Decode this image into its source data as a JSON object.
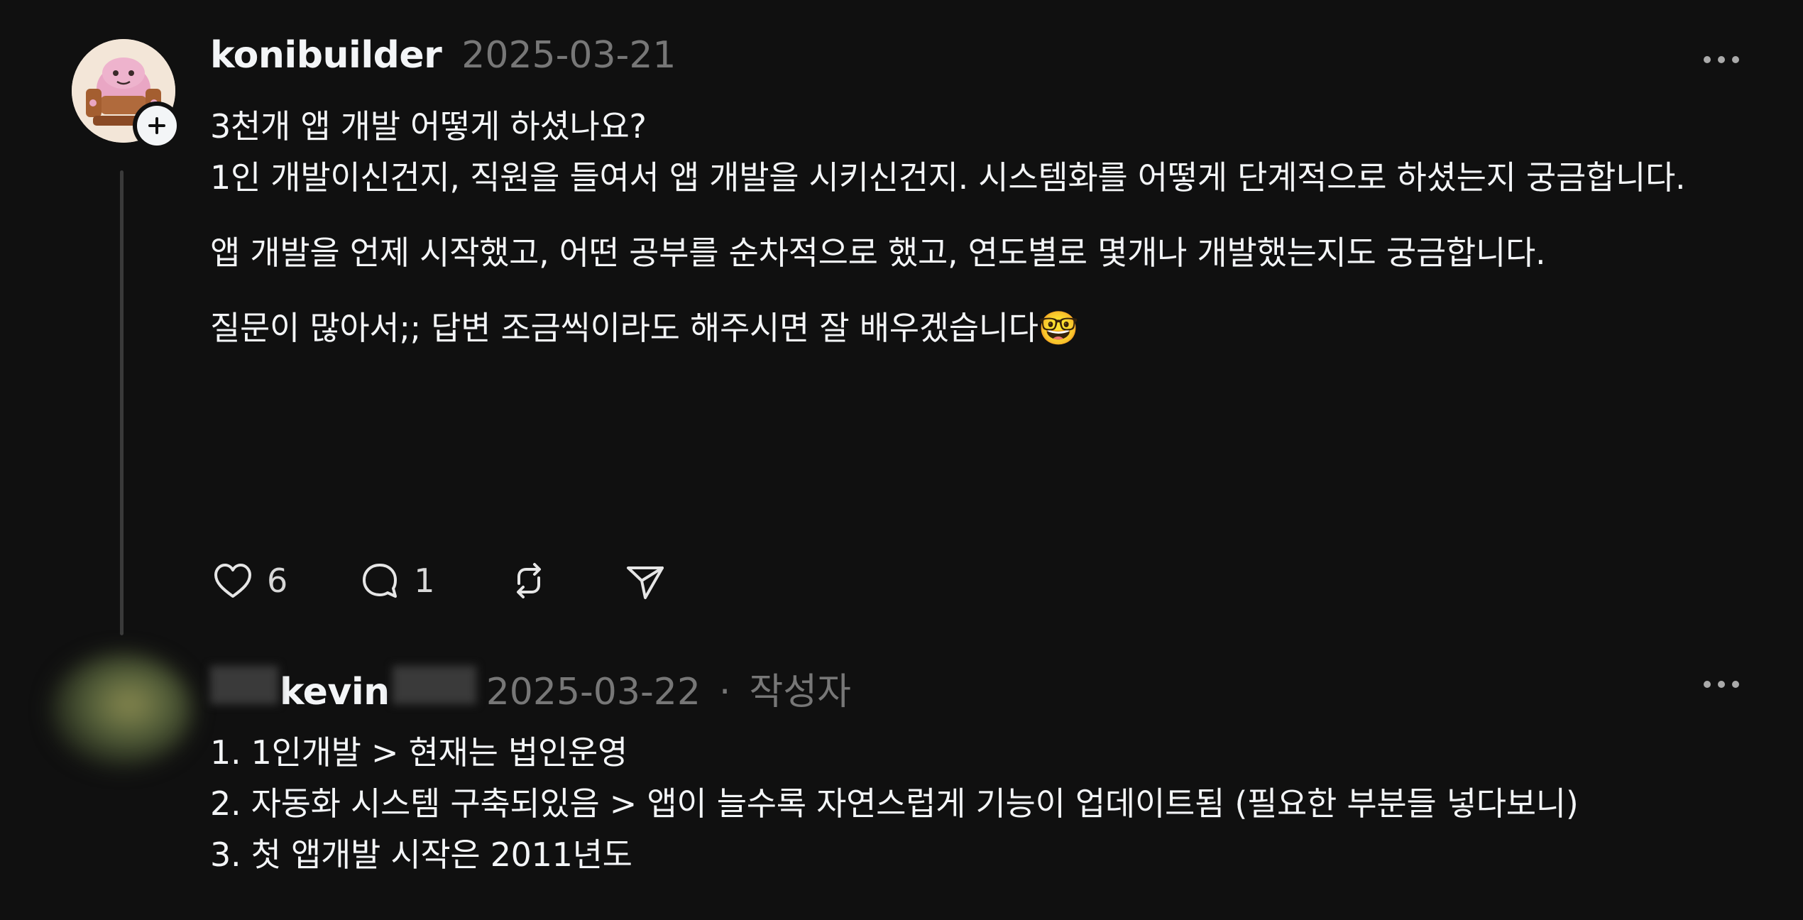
{
  "post": {
    "username": "konibuilder",
    "date": "2025-03-21",
    "paragraphs": [
      "3천개 앱 개발 어떻게 하셨나요?\n1인 개발이신건지, 직원을 들여서 앱 개발을 시키신건지. 시스템화를 어떻게 단계적으로 하셨는지 궁금합니다.",
      "앱 개발을 언제 시작했고, 어떤 공부를 순차적으로 했고, 연도별로 몇개나 개발했는지도 궁금합니다.",
      "질문이 많아서;; 답변 조금씩이라도 해주시면 잘 배우겠습니다🤓"
    ],
    "like_count": "6",
    "reply_count": "1",
    "icons": {
      "avatar": "avatar",
      "follow": "plus-icon",
      "more": "more-horizontal-icon",
      "like": "heart-icon",
      "reply": "comment-bubble-icon",
      "repost": "repost-icon",
      "share": "send-icon"
    }
  },
  "reply": {
    "username": "kevin",
    "date": "2025-03-22",
    "separator": "·",
    "author_tag": "작성자",
    "lines": [
      "1. 1인개발 > 현재는 법인운영",
      "2. 자동화 시스템 구축되있음 > 앱이 늘수록 자연스럽게 기능이 업데이트됨 (필요한 부분들 넣다보니)",
      "3. 첫 앱개발 시작은 2011년도"
    ]
  },
  "colors": {
    "background": "#101010",
    "text_primary": "#f3f5f7",
    "text_secondary": "#777777",
    "thread_line": "#3a3a3a"
  }
}
